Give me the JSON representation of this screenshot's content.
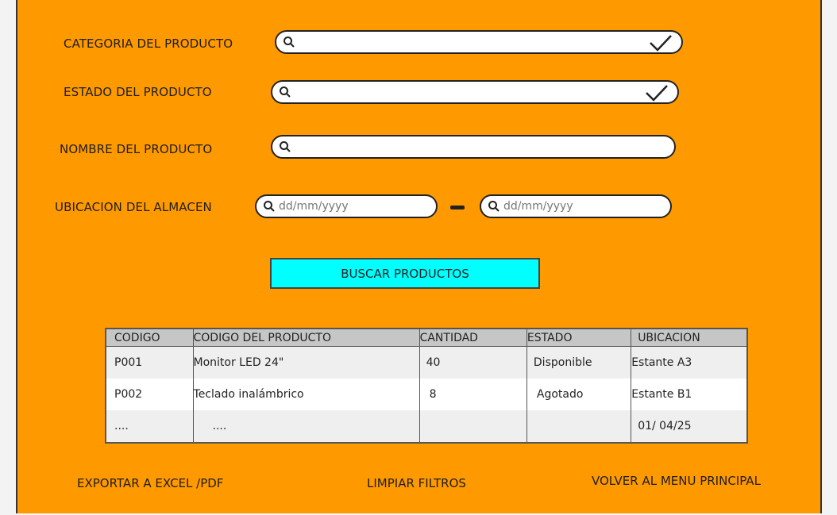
{
  "filters": {
    "category": {
      "label": "CATEGORIA DEL PRODUCTO",
      "value": ""
    },
    "status": {
      "label": "ESTADO DEL PRODUCTO",
      "value": ""
    },
    "name": {
      "label": "NOMBRE DEL PRODUCTO",
      "value": ""
    },
    "location": {
      "label": "UBICACION DEL ALMACEN",
      "from_placeholder": "dd/mm/yyyy",
      "to_placeholder": "dd/mm/yyyy"
    }
  },
  "search_button": {
    "label": "BUSCAR PRODUCTOS"
  },
  "table": {
    "headers": [
      "CODIGO",
      "CODIGO DEL PRODUCTO",
      "CANTIDAD",
      "ESTADO",
      "UBICACION"
    ],
    "rows": [
      [
        "P001",
        "Monitor LED 24\"",
        "40",
        "Disponible",
        "Estante A3"
      ],
      [
        "P002",
        "Teclado inalámbrico",
        "8",
        "Agotado",
        "Estante B1"
      ],
      [
        "....",
        "....",
        "",
        "",
        "01/ 04/25"
      ]
    ]
  },
  "footer": {
    "export_label": "EXPORTAR  A EXCEL /PDF",
    "clear_label": "LIMPIAR FILTROS",
    "back_label": "VOLVER AL MENU PRINCIPAL"
  },
  "colors": {
    "background": "#ff9900",
    "button": "#00ffff",
    "table_header": "#c6c6c6"
  },
  "icons": [
    "search-icon",
    "check-icon"
  ]
}
